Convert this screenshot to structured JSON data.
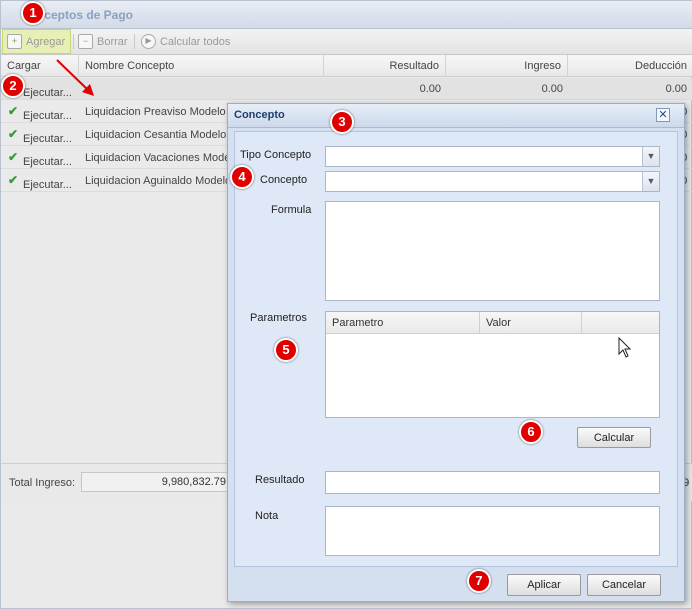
{
  "panel": {
    "title": "Conceptos de Pago"
  },
  "toolbar": {
    "add_label": "Agregar",
    "delete_label": "Borrar",
    "calc_all_label": "Calcular todos"
  },
  "grid": {
    "columns": [
      "Cargar",
      "Nombre Concepto",
      "Resultado",
      "Ingreso",
      "Deducción"
    ],
    "rows": [
      {
        "action": "Ejecutar...",
        "name": "",
        "resultado": "0.00",
        "ingreso": "0.00",
        "deduccion": "0.00"
      },
      {
        "action": "Ejecutar...",
        "name": "Liquidacion Preaviso Modelo",
        "deduccion": "00"
      },
      {
        "action": "Ejecutar...",
        "name": "Liquidacion Cesantia Modelo",
        "deduccion": "00"
      },
      {
        "action": "Ejecutar...",
        "name": "Liquidacion Vacaciones Mode",
        "deduccion": "00"
      },
      {
        "action": "Ejecutar...",
        "name": "Liquidacion Aguinaldo Modelo",
        "deduccion": "00"
      }
    ]
  },
  "footer": {
    "total_ingreso_label": "Total Ingreso:",
    "total_ingreso_value": "9,980,832.79",
    "right_fragment": "79"
  },
  "dialog": {
    "title": "Concepto",
    "close_glyph": "✕",
    "labels": {
      "tipo_concepto": "Tipo Concepto",
      "concepto": "Concepto",
      "formula": "Formula",
      "parametros": "Parametros",
      "resultado": "Resultado",
      "nota": "Nota"
    },
    "param_columns": [
      "Parametro",
      "Valor"
    ],
    "calcular_label": "Calcular",
    "aplicar_label": "Aplicar",
    "cancelar_label": "Cancelar"
  },
  "callouts": [
    "1",
    "2",
    "3",
    "4",
    "5",
    "6",
    "7"
  ],
  "colors": {
    "callout": "#e00000",
    "dialog_bg": "#dfe8f6",
    "title": "#1f3e6f"
  }
}
